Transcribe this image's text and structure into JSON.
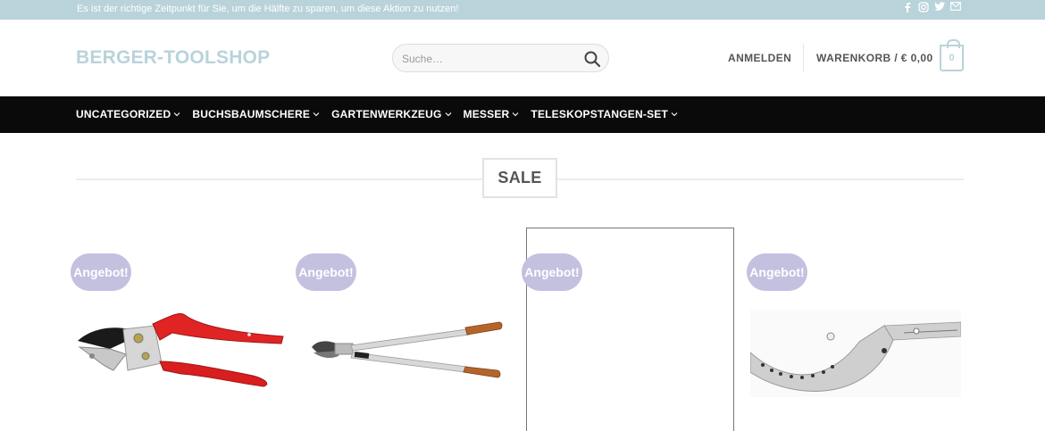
{
  "topbar": {
    "message": "Es ist der richtige Zeitpunkt für Sie, um die Hälfte zu sparen, um diese Aktion zu nutzen!",
    "social_icons": [
      "facebook-icon",
      "instagram-icon",
      "twitter-icon",
      "email-icon"
    ]
  },
  "header": {
    "logo": "BERGER-TOOLSHOP",
    "search_placeholder": "Suche…",
    "login_label": "ANMELDEN",
    "cart_label": "WARENKORB / € 0,00",
    "cart_count": "0"
  },
  "nav": {
    "items": [
      {
        "label": "UNCATEGORIZED"
      },
      {
        "label": "BUCHSBAUMSCHERE"
      },
      {
        "label": "GARTENWERKZEUG"
      },
      {
        "label": "MESSER"
      },
      {
        "label": "TELESKOPSTANGEN-SET"
      }
    ]
  },
  "main": {
    "section_title": "SALE",
    "products": [
      {
        "badge": "Angebot!",
        "image": "red-handled-pruning-shears"
      },
      {
        "badge": "Angebot!",
        "image": "long-handled-lopper"
      },
      {
        "badge": "Angebot!",
        "image": "blank"
      },
      {
        "badge": "Angebot!",
        "image": "pruning-saw-blade"
      }
    ]
  },
  "colors": {
    "accent": "#b9d3da",
    "nav_bg": "#0a0a0a",
    "badge_bg": "#c4c0e0"
  }
}
